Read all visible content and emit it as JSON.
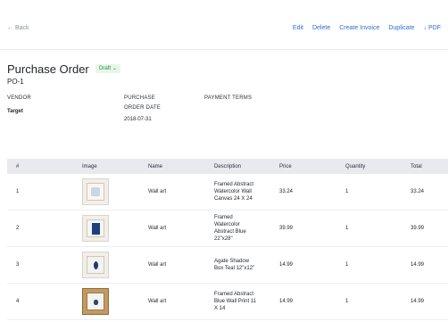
{
  "header": {
    "back_label": "Back",
    "actions": [
      "Edit",
      "Delete",
      "Create Invoice",
      "Duplicate",
      "PDF"
    ]
  },
  "order": {
    "title": "Purchase Order",
    "status": "Draft",
    "number": "PO-1",
    "vendor_label": "VENDOR",
    "vendor_value": "Target",
    "purchase_label_line1": "PURCHASE",
    "purchase_label_line2": "ORDER DATE",
    "purchase_date": "2018-07-31",
    "payment_terms_label": "PAYMENT TERMS"
  },
  "table": {
    "headers": [
      "#",
      "Image",
      "Name",
      "Description",
      "Price",
      "Quantity",
      "Total"
    ],
    "rows": [
      {
        "num": "1",
        "image": "framed-art-1",
        "name": "Wall art",
        "desc_lines": [
          "Framed Abstract",
          "Watercolor Wall",
          "Canvas 24 X 24"
        ],
        "price": "33.24",
        "qty": "1",
        "total": "33.24"
      },
      {
        "num": "2",
        "image": "framed-art-2",
        "name": "Wall art",
        "desc_lines": [
          "Framed",
          "Watercolor",
          "Abstract Blue",
          "22\"x28\""
        ],
        "price": "39.99",
        "qty": "1",
        "total": "39.99"
      },
      {
        "num": "3",
        "image": "framed-art-3",
        "name": "Wall art",
        "desc_lines": [
          "Agate Shadow",
          "Box Teal 12\"x12\""
        ],
        "price": "14.99",
        "qty": "1",
        "total": "14.99"
      },
      {
        "num": "4",
        "image": "framed-art-4",
        "name": "Wall art",
        "desc_lines": [
          "Framed Abstract",
          "Blue Wall Print 11",
          "X 14"
        ],
        "price": "14.99",
        "qty": "1",
        "total": "14.99"
      }
    ]
  },
  "colors": {
    "accent": "#2f6fd1",
    "status_bg": "#e8f6ea",
    "status_text": "#2a8a3a",
    "header_row_bg": "#e9eaee"
  }
}
